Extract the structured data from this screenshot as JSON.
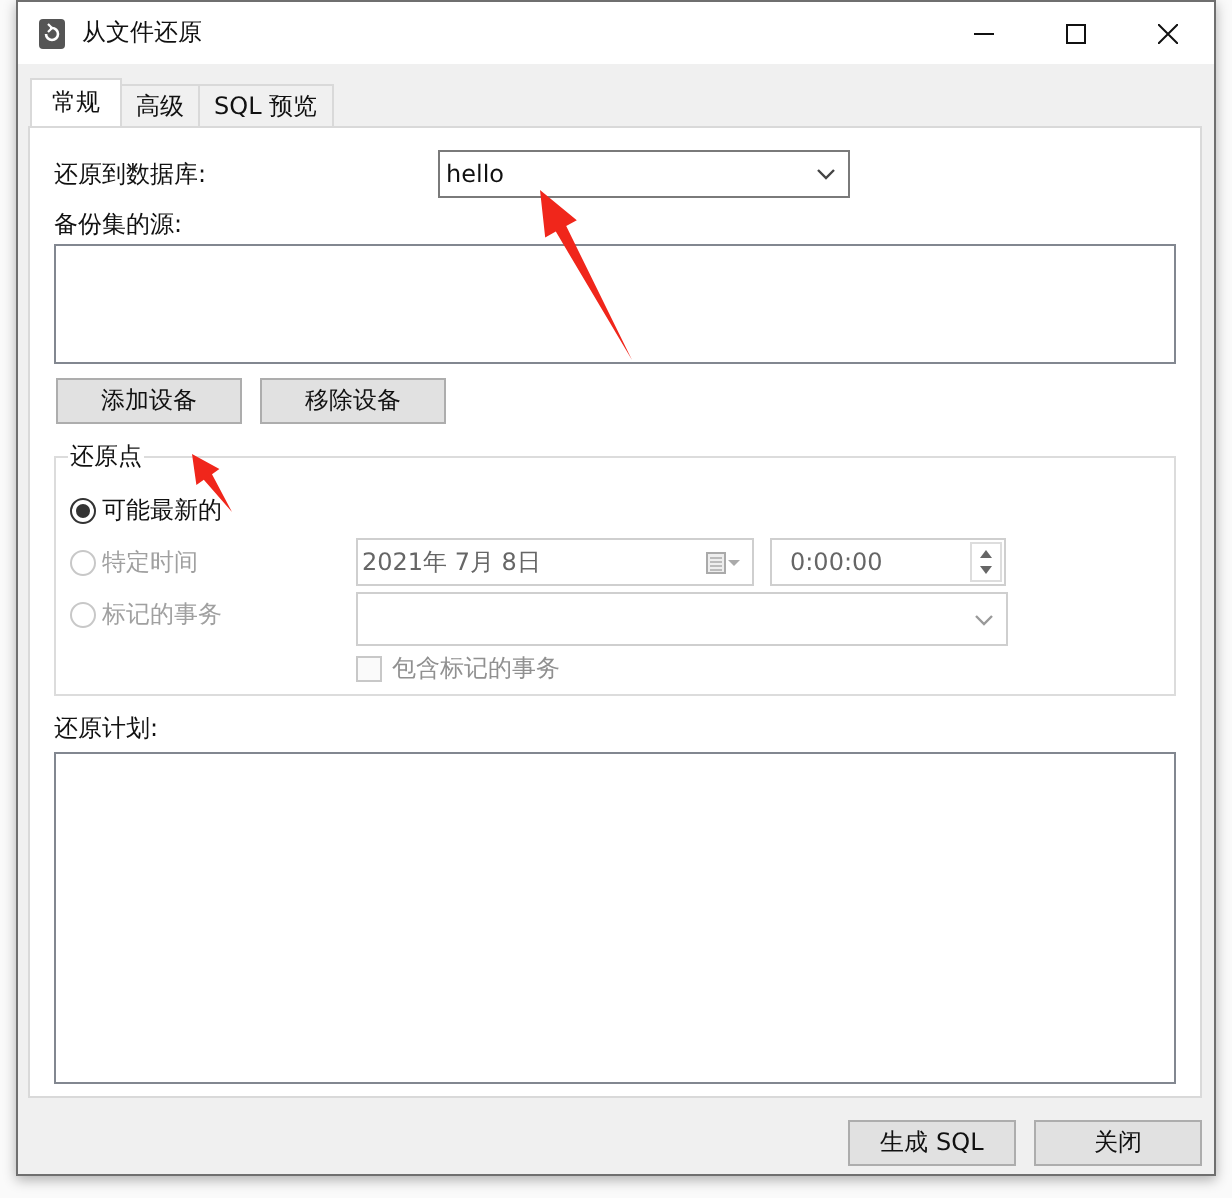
{
  "window": {
    "title": "从文件还原"
  },
  "tabs": [
    {
      "label": "常规",
      "selected": true
    },
    {
      "label": "高级",
      "selected": false
    },
    {
      "label": "SQL 预览",
      "selected": false
    }
  ],
  "restore_to": {
    "label": "还原到数据库:",
    "value": "hello"
  },
  "backup_source": {
    "label": "备份集的源:"
  },
  "device_buttons": [
    "添加设备",
    "移除设备"
  ],
  "restore_point": {
    "title": "还原点",
    "options": [
      {
        "label": "可能最新的",
        "selected": true,
        "disabled": false
      },
      {
        "label": "特定时间",
        "selected": false,
        "disabled": true
      },
      {
        "label": "标记的事务",
        "selected": false,
        "disabled": true
      }
    ],
    "date": "2021年  7月  8日",
    "time": "0:00:00",
    "include_marked": {
      "label": "包含标记的事务",
      "checked": false,
      "disabled": true
    }
  },
  "restore_plan": {
    "label": "还原计划:"
  },
  "buttons": [
    "生成 SQL",
    "关闭"
  ]
}
